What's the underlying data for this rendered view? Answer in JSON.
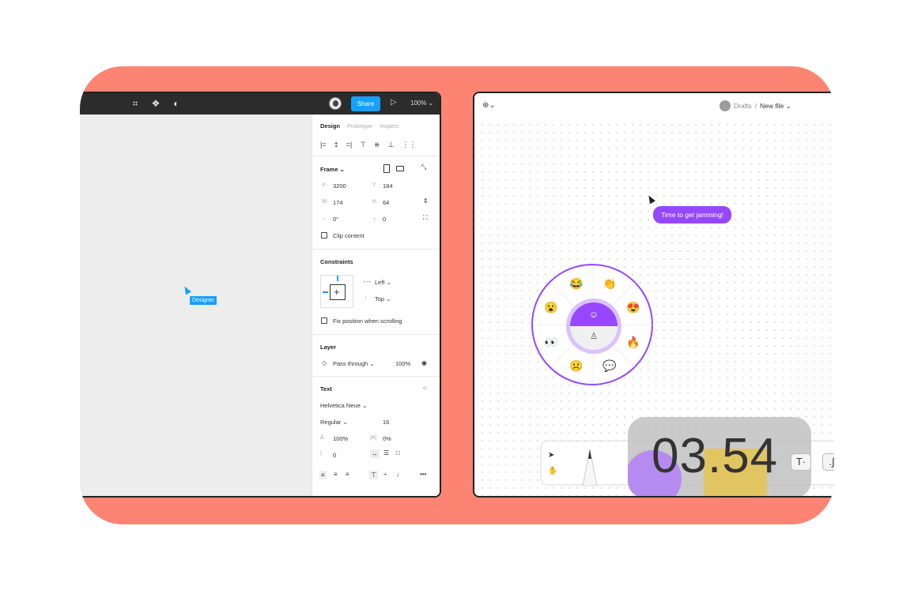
{
  "colors": {
    "background_panel": "#fd8472",
    "accent_blue": "#18a0fb",
    "accent_purple": "#9747ff"
  },
  "left": {
    "toolbar": {
      "icons": [
        "frame-icon",
        "component-icon",
        "contrast-icon"
      ],
      "share_label": "Share",
      "zoom_label": "100% ⌄"
    },
    "canvas": {
      "cursor_label": "Designer"
    },
    "panel": {
      "tabs": [
        "Design",
        "Prototype",
        "Inspect"
      ],
      "frame": {
        "title": "Frame ⌄",
        "x_label": "X",
        "x": "3200",
        "y_label": "Y",
        "y": "184",
        "w_label": "W",
        "w": "174",
        "h_label": "H",
        "h": "64",
        "rotation": "0°",
        "radius": "0",
        "clip_label": "Clip content"
      },
      "constraints": {
        "title": "Constraints",
        "horizontal": "Left ⌄",
        "vertical": "Top ⌄",
        "fix_label": "Fix position when scrolling"
      },
      "layer": {
        "title": "Layer",
        "blend": "Pass through ⌄",
        "opacity": "100%"
      },
      "text": {
        "title": "Text",
        "font": "Helvetica Neue ⌄",
        "weight": "Regular ⌄",
        "size": "16",
        "line_height": "100%",
        "letter_spacing": "0%",
        "paragraph_spacing": "0"
      }
    }
  },
  "right": {
    "breadcrumb": {
      "folder": "Drafts",
      "separator": "/",
      "file": "New file ⌄"
    },
    "bubble": "Time to get jamming!",
    "emojis": [
      "😂",
      "👏",
      "😍",
      "🔥",
      "💬",
      "☹️",
      "👀",
      "😮"
    ],
    "timer": "03.54"
  }
}
